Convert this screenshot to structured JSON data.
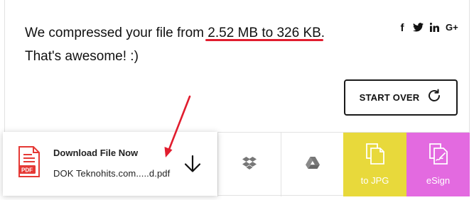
{
  "message": {
    "prefix": "We compressed your file from ",
    "highlight": "2.52 MB to 326 KB",
    "suffix": ".",
    "line2": "That's awesome! :)"
  },
  "social": {
    "facebook_glyph": "f",
    "googleplus_glyph": "G+",
    "icons": [
      "facebook-icon",
      "twitter-icon",
      "linkedin-icon",
      "googleplus-icon"
    ]
  },
  "start_over": {
    "label": "START OVER",
    "icon": "refresh-icon"
  },
  "download": {
    "title": "Download File Now",
    "filename": "DOK Teknohits.com.....d.pdf",
    "badge": "PDF",
    "icon": "download-arrow-icon"
  },
  "tiles": {
    "dropbox_icon": "dropbox-icon",
    "drive_icon": "google-drive-icon",
    "to_jpg": "to JPG",
    "esign": "eSign"
  },
  "colors": {
    "underline": "#e11d2e",
    "jpg_tile": "#e8d93b",
    "esign_tile": "#e36ae0",
    "pdf_red": "#e53935",
    "annotation_arrow": "#e11d2e"
  }
}
